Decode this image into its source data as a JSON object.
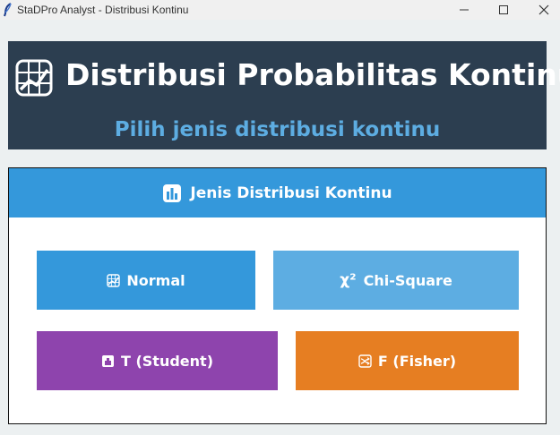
{
  "window": {
    "title": "StaDPro Analyst - Distribusi Kontinu",
    "controls": [
      "minimize",
      "maximize",
      "close"
    ]
  },
  "header": {
    "icon": "chart-icon",
    "title": "Distribusi Probabilitas Kontinu",
    "subtitle": "Pilih jenis distribusi kontinu"
  },
  "panel": {
    "icon": "bar-chart-icon",
    "title": "Jenis Distribusi Kontinu",
    "buttons": [
      {
        "label": "Normal",
        "icon": "chart-icon",
        "color": "#3498db"
      },
      {
        "label": "Chi-Square",
        "symbol": "χ²",
        "color": "#5dade2"
      },
      {
        "label": "T (Student)",
        "icon": "t-box-icon",
        "color": "#8e44ad"
      },
      {
        "label": "F (Fisher)",
        "icon": "shuffle-icon",
        "color": "#e67e22"
      }
    ]
  },
  "colors": {
    "background": "#ecf0f1",
    "header_bg": "#2c3e50",
    "header_subtitle": "#5dade2",
    "panel_head": "#3498db"
  }
}
